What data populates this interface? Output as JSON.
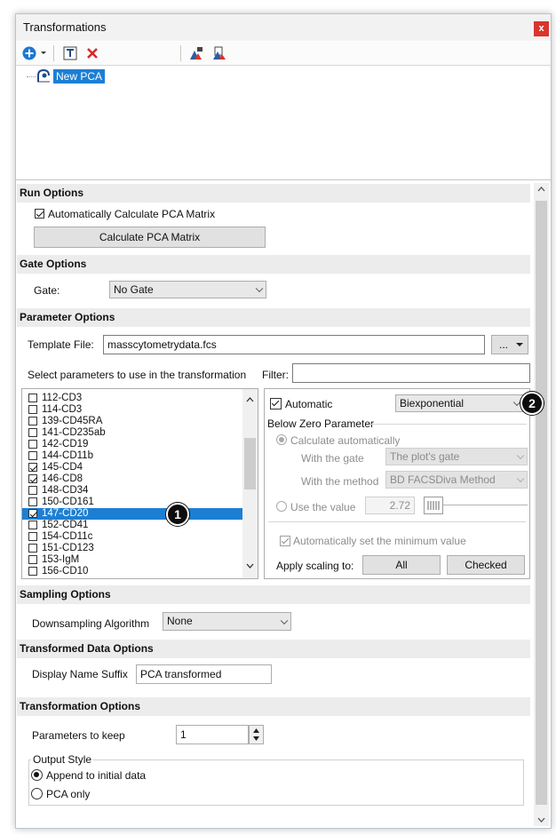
{
  "window": {
    "title": "Transformations",
    "close": "x"
  },
  "toolbar": {
    "items": [
      "add-icon",
      "dropdown-icon",
      "template-icon",
      "delete-icon",
      "export-icon",
      "copy-icon"
    ]
  },
  "tree": {
    "item": "New PCA"
  },
  "run_options": {
    "header": "Run Options",
    "auto_calc_label": "Automatically Calculate PCA Matrix",
    "auto_calc_checked": true,
    "calc_button": "Calculate PCA Matrix"
  },
  "gate_options": {
    "header": "Gate Options",
    "gate_label": "Gate:",
    "gate_value": "No Gate"
  },
  "parameter_options": {
    "header": "Parameter Options",
    "template_label": "Template File:",
    "template_value": "masscytometrydata.fcs",
    "browse_label": "...",
    "select_label": "Select parameters to use in the transformation",
    "filter_label": "Filter:",
    "filter_value": "",
    "params": [
      {
        "name": "112-CD3",
        "checked": false,
        "selected": false
      },
      {
        "name": "114-CD3",
        "checked": false,
        "selected": false
      },
      {
        "name": "139-CD45RA",
        "checked": false,
        "selected": false
      },
      {
        "name": "141-CD235ab",
        "checked": false,
        "selected": false
      },
      {
        "name": "142-CD19",
        "checked": false,
        "selected": false
      },
      {
        "name": "144-CD11b",
        "checked": false,
        "selected": false
      },
      {
        "name": "145-CD4",
        "checked": true,
        "selected": false
      },
      {
        "name": "146-CD8",
        "checked": true,
        "selected": false
      },
      {
        "name": "148-CD34",
        "checked": false,
        "selected": false
      },
      {
        "name": "150-CD161",
        "checked": false,
        "selected": false
      },
      {
        "name": "147-CD20",
        "checked": true,
        "selected": true
      },
      {
        "name": "152-CD41",
        "checked": false,
        "selected": false
      },
      {
        "name": "154-CD11c",
        "checked": false,
        "selected": false
      },
      {
        "name": "151-CD123",
        "checked": false,
        "selected": false
      },
      {
        "name": "153-IgM",
        "checked": false,
        "selected": false
      },
      {
        "name": "156-CD10",
        "checked": false,
        "selected": false
      }
    ],
    "scaling": {
      "automatic_label": "Automatic",
      "automatic_checked": true,
      "scale_value": "Biexponential",
      "below_zero_label": "Below Zero Parameter",
      "calc_auto_label": "Calculate automatically",
      "with_gate_label": "With the gate",
      "with_gate_value": "The plot's gate",
      "with_method_label": "With the method",
      "with_method_value": "BD FACSDiva Method",
      "use_value_label": "Use the value",
      "use_value": "2.72",
      "auto_min_label": "Automatically set the minimum value",
      "apply_label": "Apply scaling to:",
      "all_button": "All",
      "checked_button": "Checked"
    }
  },
  "sampling_options": {
    "header": "Sampling Options",
    "algo_label": "Downsampling Algorithm",
    "algo_value": "None"
  },
  "transformed_data_options": {
    "header": "Transformed Data Options",
    "suffix_label": "Display Name Suffix",
    "suffix_value": "PCA transformed"
  },
  "transformation_options": {
    "header": "Transformation Options",
    "keep_label": "Parameters to keep",
    "keep_value": "1",
    "output_style_label": "Output Style",
    "append_label": "Append to initial data",
    "pca_only_label": "PCA only"
  },
  "callouts": {
    "one": "1",
    "two": "2"
  },
  "colors": {
    "selection": "#1c7fd3",
    "section_bg": "#ececec",
    "close": "#d9352b"
  }
}
